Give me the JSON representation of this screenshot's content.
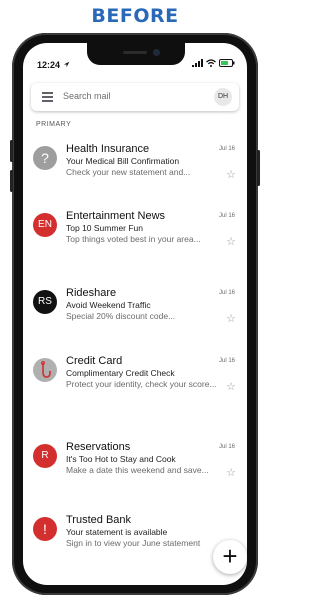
{
  "heading": "BEFORE",
  "status_bar": {
    "time": "12:24"
  },
  "search": {
    "placeholder": "Search mail",
    "account_initials": "DH"
  },
  "section_label": "PRIMARY",
  "emails": [
    {
      "avatar_text": "?",
      "avatar_color": "#9e9e9e",
      "sender": "Health Insurance",
      "subject": "Your Medical Bill Confirmation",
      "snippet": "Check your new statement and...",
      "date": "Jul 16"
    },
    {
      "avatar_text": "EN",
      "avatar_color": "#d32f2f",
      "sender": "Entertainment News",
      "subject": "Top 10 Summer Fun",
      "snippet": "Top things voted best in your area...",
      "date": "Jul 16"
    },
    {
      "avatar_text": "RS",
      "avatar_color": "#111111",
      "sender": "Rideshare",
      "subject": "Avoid Weekend Traffic",
      "snippet": "Special 20% discount code...",
      "date": "Jul 16"
    },
    {
      "avatar_text": "",
      "avatar_color": "#b0b0b0",
      "sender": "Credit Card",
      "subject": "Complimentary Credit Check",
      "snippet": "Protect your identity, check your score...",
      "date": "Jul 16"
    },
    {
      "avatar_text": "R",
      "avatar_color": "#d32f2f",
      "sender": "Reservations",
      "subject": "It's Too Hot to Stay and Cook",
      "snippet": "Make a date this weekend and save...",
      "date": "Jul 16"
    },
    {
      "avatar_text": "!",
      "avatar_color": "#d32f2f",
      "sender": "Trusted Bank",
      "subject": "Your statement is available",
      "snippet": "Sign in to view your June statement",
      "date": ""
    }
  ],
  "fab_label": "+"
}
